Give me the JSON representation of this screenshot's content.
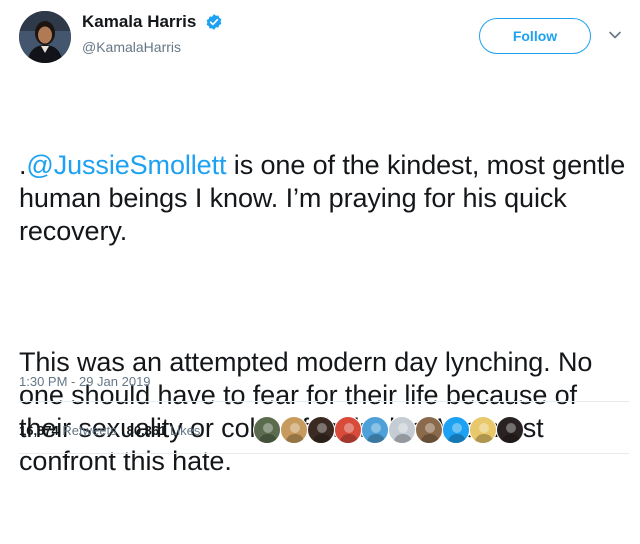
{
  "author": {
    "display_name": "Kamala Harris",
    "handle": "@KamalaHarris",
    "verified": true
  },
  "follow_button": {
    "label": "Follow"
  },
  "tweet": {
    "prefix": ".",
    "mention": "@JussieSmollett",
    "paragraph1_rest": " is one of the kindest, most gentle human beings I know. I’m praying for his quick recovery.",
    "paragraph2": "This was an attempted modern day lynching. No one should have to fear for their life because of their sexuality or color of their skin. We must confront this hate."
  },
  "timestamp": "1:30 PM - 29 Jan 2019",
  "stats": {
    "retweets_count": "16,874",
    "retweets_label": "Retweets",
    "likes_count": "80,361",
    "likes_label": "Likes"
  },
  "colors": {
    "accent": "#1da1f2",
    "muted": "#657786",
    "text": "#14171a"
  },
  "likers": [
    {
      "icon": "liker-avatar-1",
      "color": "#5a6b4e"
    },
    {
      "icon": "liker-avatar-2",
      "color": "#c79b5d"
    },
    {
      "icon": "liker-avatar-3",
      "color": "#3a2a22"
    },
    {
      "icon": "liker-avatar-4",
      "color": "#d84a3a"
    },
    {
      "icon": "liker-avatar-5",
      "color": "#4ea0d8"
    },
    {
      "icon": "liker-avatar-6",
      "color": "#c5ccd3"
    },
    {
      "icon": "liker-avatar-7",
      "color": "#8a6a4a"
    },
    {
      "icon": "liker-avatar-8",
      "color": "#1da1f2"
    },
    {
      "icon": "liker-avatar-9",
      "color": "#e8c86a"
    },
    {
      "icon": "liker-avatar-10",
      "color": "#2a2222"
    }
  ]
}
